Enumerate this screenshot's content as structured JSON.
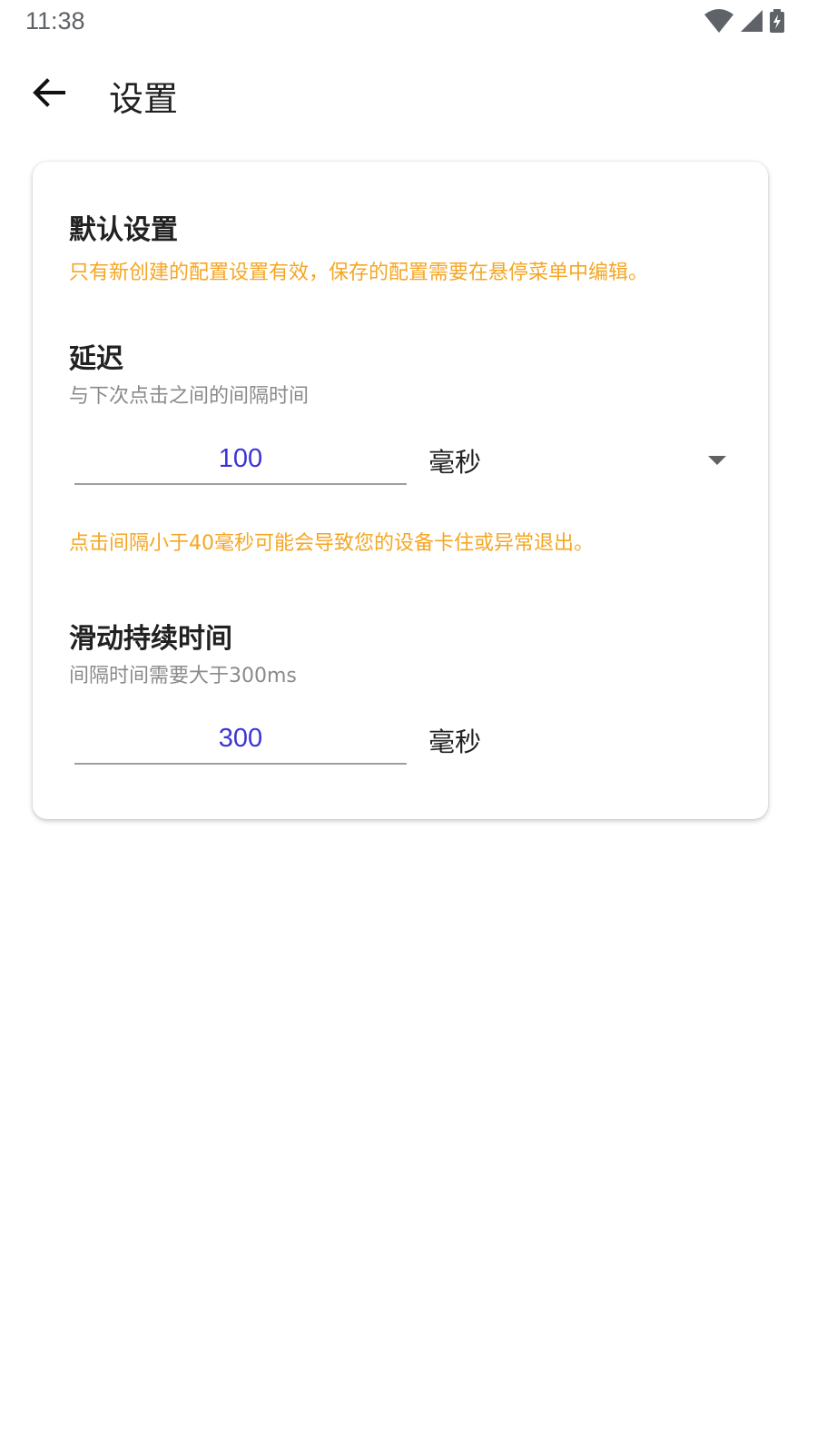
{
  "status_bar": {
    "time": "11:38",
    "icons": [
      "wifi-icon",
      "cell-signal-icon",
      "battery-charging-icon"
    ]
  },
  "app_bar": {
    "title": "设置",
    "back_icon": "arrow-back-icon"
  },
  "card": {
    "default_section": {
      "title": "默认设置",
      "note": "只有新创建的配置设置有效，保存的配置需要在悬停菜单中编辑。"
    },
    "delay": {
      "title": "延迟",
      "subtitle": "与下次点击之间的间隔时间",
      "value": "100",
      "unit": "毫秒",
      "warning": "点击间隔小于40毫秒可能会导致您的设备卡住或异常退出。"
    },
    "swipe_duration": {
      "title": "滑动持续时间",
      "subtitle": "间隔时间需要大于300ms",
      "value": "300",
      "unit": "毫秒"
    }
  },
  "colors": {
    "accent": "#3a33d6",
    "warning": "#f5a623",
    "secondary_text": "#8a8a8a"
  }
}
